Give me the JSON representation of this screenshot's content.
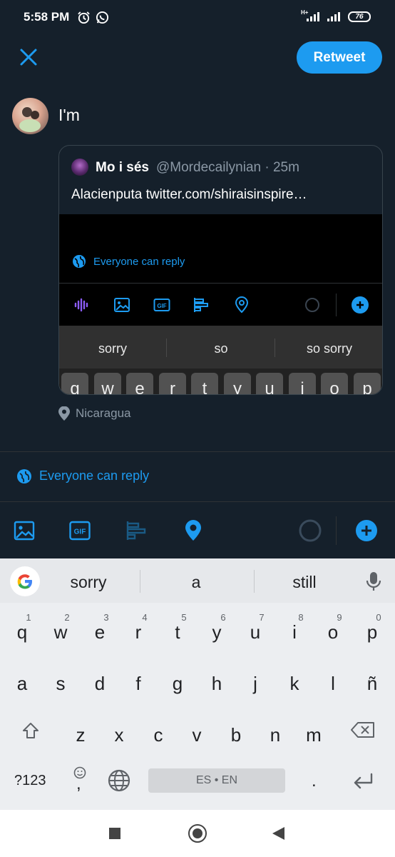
{
  "status_bar": {
    "time": "5:58 PM",
    "network": "H+",
    "battery": "76"
  },
  "compose": {
    "close_icon": "close-icon",
    "retweet_label": "Retweet",
    "text": "I'm"
  },
  "quoted_tweet": {
    "name": "Mo i sés",
    "handle_time": "@Mordecailynian · 25m",
    "text": "Alacienputa twitter.com/shiraisinspire…",
    "screenshot": {
      "reply_label": "Everyone can reply",
      "suggestions": [
        "sorry",
        "so",
        "so sorry"
      ],
      "keys": [
        "q",
        "w",
        "e",
        "r",
        "t",
        "y",
        "u",
        "i",
        "o",
        "p"
      ]
    }
  },
  "location": "Nicaragua",
  "reply_setting": "Everyone can reply",
  "toolbar": {
    "icons": [
      "image-icon",
      "gif-icon",
      "poll-icon",
      "location-icon",
      "progress-ring-icon",
      "add-tweet-icon"
    ],
    "gif_label": "GIF"
  },
  "keyboard": {
    "suggestions": [
      "sorry",
      "a",
      "still"
    ],
    "row1": [
      {
        "k": "q",
        "n": "1"
      },
      {
        "k": "w",
        "n": "2"
      },
      {
        "k": "e",
        "n": "3"
      },
      {
        "k": "r",
        "n": "4"
      },
      {
        "k": "t",
        "n": "5"
      },
      {
        "k": "y",
        "n": "6"
      },
      {
        "k": "u",
        "n": "7"
      },
      {
        "k": "i",
        "n": "8"
      },
      {
        "k": "o",
        "n": "9"
      },
      {
        "k": "p",
        "n": "0"
      }
    ],
    "row2": [
      "a",
      "s",
      "d",
      "f",
      "g",
      "h",
      "j",
      "k",
      "l",
      "ñ"
    ],
    "row3": [
      "z",
      "x",
      "c",
      "v",
      "b",
      "n",
      "m"
    ],
    "symbols_label": "?123",
    "comma": ",",
    "space_label": "ES • EN",
    "period": "."
  },
  "colors": {
    "accent": "#1d9bf0",
    "background": "#15202b",
    "muted": "#8b98a5"
  }
}
